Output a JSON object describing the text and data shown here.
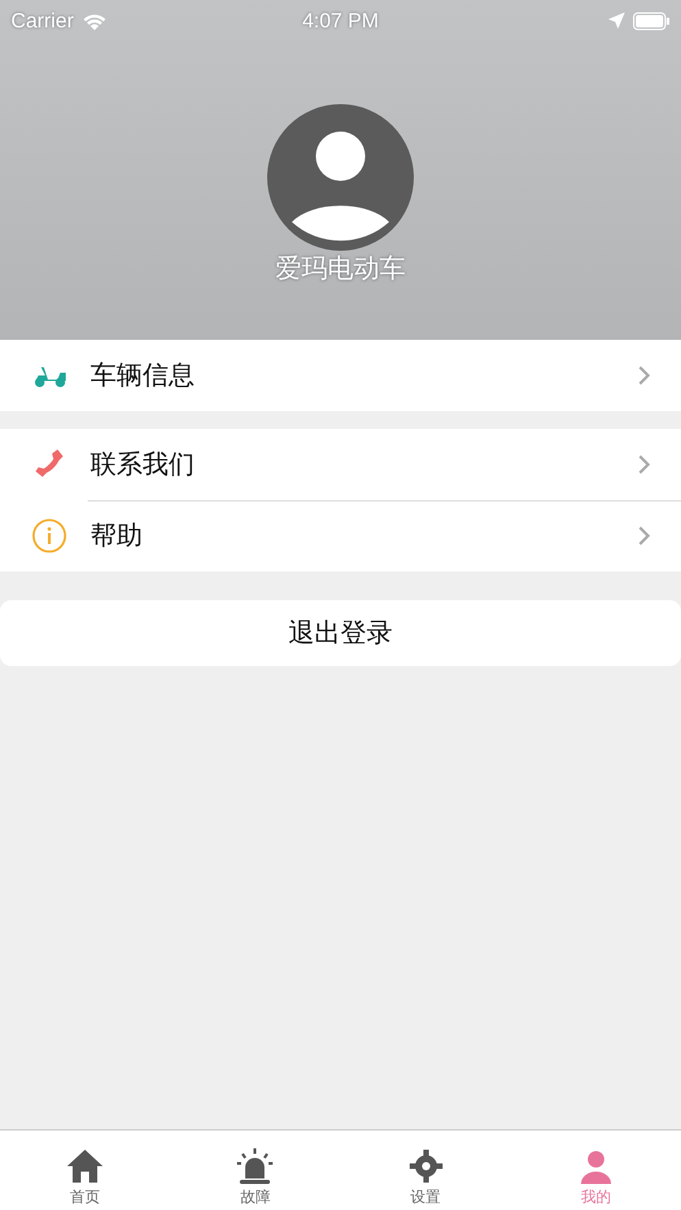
{
  "status_bar": {
    "carrier": "Carrier",
    "time": "4:07 PM"
  },
  "profile": {
    "name": "爱玛电动车"
  },
  "groups": [
    {
      "items": [
        {
          "label": "车辆信息"
        }
      ]
    },
    {
      "items": [
        {
          "label": "联系我们"
        },
        {
          "label": "帮助"
        }
      ]
    }
  ],
  "logout_button": "退出登录",
  "tab_bar": [
    {
      "label": "首页",
      "selected": false
    },
    {
      "label": "故障",
      "selected": false
    },
    {
      "label": "设置",
      "selected": false
    },
    {
      "label": "我的",
      "selected": true
    }
  ]
}
